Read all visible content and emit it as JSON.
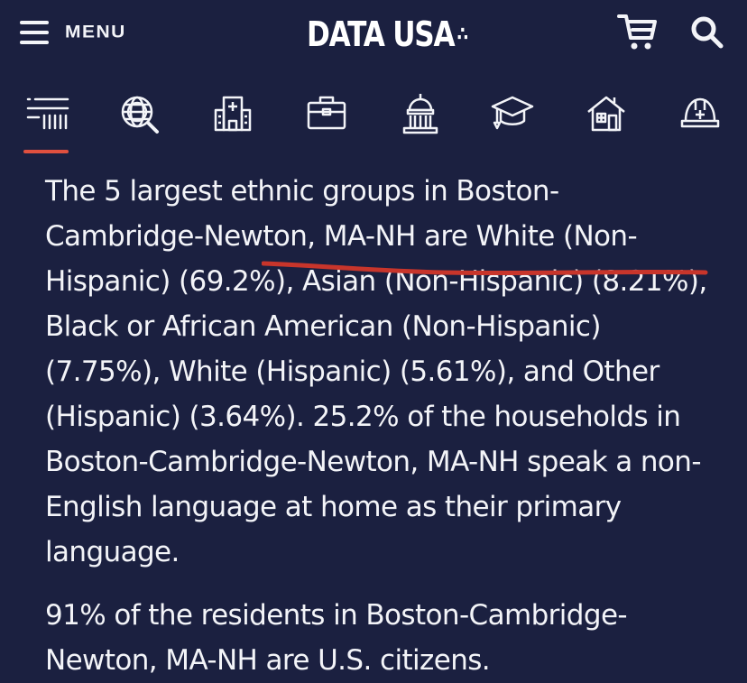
{
  "header": {
    "menu_label": "MENU",
    "logo_text": "DATA USA",
    "logo_mark": "∴"
  },
  "nav": {
    "items": [
      {
        "icon": "list-icon",
        "active": true
      },
      {
        "icon": "globe-search-icon",
        "active": false
      },
      {
        "icon": "hospital-icon",
        "active": false
      },
      {
        "icon": "briefcase-icon",
        "active": false
      },
      {
        "icon": "capitol-icon",
        "active": false
      },
      {
        "icon": "graduation-cap-icon",
        "active": false
      },
      {
        "icon": "house-icon",
        "active": false
      },
      {
        "icon": "safety-helmet-icon",
        "active": false
      }
    ],
    "active_color": "#e0503f"
  },
  "content": {
    "paragraph_1": "The 5 largest ethnic groups in Boston-Cambridge-Newton, MA-NH are White (Non-Hispanic) (69.2%), Asian (Non-Hispanic) (8.21%), Black or African American (Non-Hispanic) (7.75%), White (Hispanic) (5.61%), and Other (Hispanic) (3.64%). 25.2% of the households in Boston-Cambridge-Newton, MA-NH speak a non-English language at home as their primary language.",
    "paragraph_2": "91% of the residents in Boston-Cambridge-Newton, MA-NH are U.S. citizens."
  },
  "colors": {
    "background": "#1b2040",
    "text": "#f3f4f8",
    "accent": "#e0503f",
    "annotation": "#c8352b"
  }
}
